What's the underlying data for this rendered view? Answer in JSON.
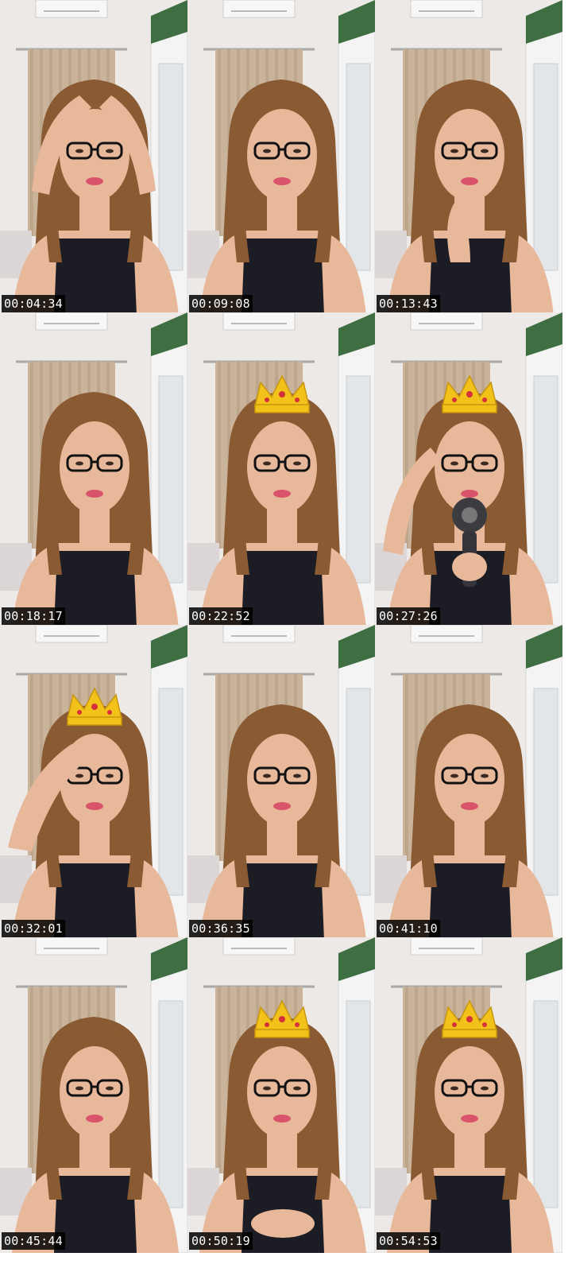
{
  "frames": [
    {
      "timestamp": "00:04:34",
      "crown": false,
      "hands": "head"
    },
    {
      "timestamp": "00:09:08",
      "crown": false,
      "hands": "none"
    },
    {
      "timestamp": "00:13:43",
      "crown": false,
      "hands": "lip"
    },
    {
      "timestamp": "00:18:17",
      "crown": false,
      "hands": "none"
    },
    {
      "timestamp": "00:22:52",
      "crown": true,
      "hands": "none"
    },
    {
      "timestamp": "00:27:26",
      "crown": true,
      "hands": "dryer"
    },
    {
      "timestamp": "00:32:01",
      "crown": true,
      "hands": "forehead"
    },
    {
      "timestamp": "00:36:35",
      "crown": false,
      "hands": "none"
    },
    {
      "timestamp": "00:41:10",
      "crown": false,
      "hands": "none"
    },
    {
      "timestamp": "00:45:44",
      "crown": false,
      "hands": "none"
    },
    {
      "timestamp": "00:50:19",
      "crown": true,
      "hands": "front"
    },
    {
      "timestamp": "00:54:53",
      "crown": true,
      "hands": "none"
    }
  ],
  "colors": {
    "wall": "#ece9e6",
    "curtain": "#c9b39a",
    "hair": "#8a5a32",
    "skin": "#e8b89b",
    "top": "#1c1c24",
    "glasses": "#111111",
    "crown": "#f2c21b",
    "timestamp_bg": "#000000",
    "timestamp_text": "#ffffff"
  }
}
